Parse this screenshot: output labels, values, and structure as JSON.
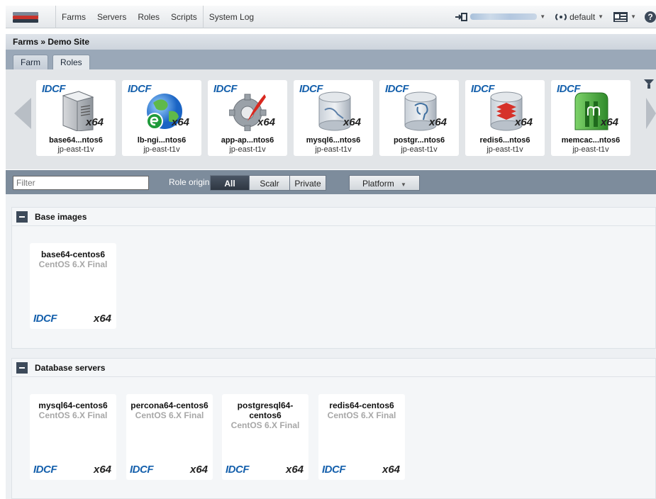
{
  "nav": {
    "items": [
      "Farms",
      "Servers",
      "Roles",
      "Scripts",
      "System Log"
    ],
    "environment": "default"
  },
  "breadcrumb": "Farms » Demo Site",
  "tabs": [
    {
      "label": "Farm",
      "active": false
    },
    {
      "label": "Roles",
      "active": true
    }
  ],
  "roles": [
    {
      "name": "base64...ntos6",
      "location": "jp-east-t1v",
      "brand": "IDCF",
      "arch": "x64",
      "icon": "server-tower-icon"
    },
    {
      "name": "lb-ngi...ntos6",
      "location": "jp-east-t1v",
      "brand": "IDCF",
      "arch": "x64",
      "icon": "globe-icon"
    },
    {
      "name": "app-ap...ntos6",
      "location": "jp-east-t1v",
      "brand": "IDCF",
      "arch": "x64",
      "icon": "gear-feather-icon"
    },
    {
      "name": "mysql6...ntos6",
      "location": "jp-east-t1v",
      "brand": "IDCF",
      "arch": "x64",
      "icon": "mysql-database-icon"
    },
    {
      "name": "postgr...ntos6",
      "location": "jp-east-t1v",
      "brand": "IDCF",
      "arch": "x64",
      "icon": "postgresql-database-icon"
    },
    {
      "name": "redis6...ntos6",
      "location": "jp-east-t1v",
      "brand": "IDCF",
      "arch": "x64",
      "icon": "redis-database-icon"
    },
    {
      "name": "memcac...ntos6",
      "location": "jp-east-t1v",
      "brand": "IDCF",
      "arch": "x64",
      "icon": "memcached-icon"
    }
  ],
  "filter": {
    "placeholder": "Filter",
    "role_origin_label": "Role origin:",
    "origins": [
      {
        "label": "All",
        "active": true
      },
      {
        "label": "Scalr",
        "active": false
      },
      {
        "label": "Private",
        "active": false
      }
    ],
    "platform_label": "Platform"
  },
  "groups": [
    {
      "title": "Base images",
      "images": [
        {
          "name": "base64-centos6",
          "os": "CentOS 6.X Final",
          "brand": "IDCF",
          "arch": "x64"
        }
      ]
    },
    {
      "title": "Database servers",
      "images": [
        {
          "name": "mysql64-centos6",
          "os": "CentOS 6.X Final",
          "brand": "IDCF",
          "arch": "x64"
        },
        {
          "name": "percona64-centos6",
          "os": "CentOS 6.X Final",
          "brand": "IDCF",
          "arch": "x64"
        },
        {
          "name": "postgresql64-\ncentos6",
          "os": "CentOS 6.X Final",
          "brand": "IDCF",
          "arch": "x64"
        },
        {
          "name": "redis64-centos6",
          "os": "CentOS 6.X Final",
          "brand": "IDCF",
          "arch": "x64"
        }
      ]
    }
  ]
}
